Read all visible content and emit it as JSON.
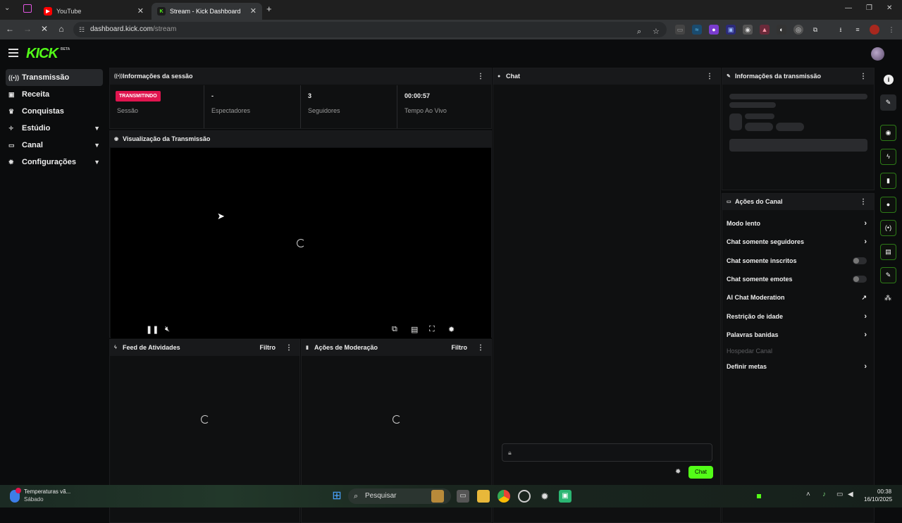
{
  "browser": {
    "tabs": [
      {
        "title": "YouTube",
        "favicon": "youtube-icon"
      },
      {
        "title": "Stream - Kick Dashboard",
        "favicon": "kick-icon",
        "active": true
      }
    ],
    "url_host": "dashboard.kick.com",
    "url_path": "/stream"
  },
  "app": {
    "logo": "KICK",
    "logo_badge": "BETA",
    "accent": "#53fc18",
    "live_color": "#e0154f"
  },
  "sidebar": {
    "items": [
      {
        "label": "Transmissão",
        "icon": "broadcast-icon",
        "active": true
      },
      {
        "label": "Receita",
        "icon": "wallet-icon"
      },
      {
        "label": "Conquistas",
        "icon": "trophy-icon"
      },
      {
        "label": "Estúdio",
        "icon": "studio-icon",
        "expandable": true
      },
      {
        "label": "Canal",
        "icon": "channel-icon",
        "expandable": true
      },
      {
        "label": "Configurações",
        "icon": "gear-icon",
        "expandable": true
      }
    ]
  },
  "session": {
    "title": "Informações da sessão",
    "badge": "TRANSMITINDO",
    "stats": [
      {
        "label": "Sessão",
        "value": ""
      },
      {
        "label": "Espectadores",
        "value": "-"
      },
      {
        "label": "Seguidores",
        "value": "3"
      },
      {
        "label": "Tempo Ao Vivo",
        "value": "00:00:57"
      }
    ]
  },
  "preview": {
    "title": "Visualização da Transmissão"
  },
  "activity": {
    "title": "Feed de Atividades",
    "filter": "Filtro"
  },
  "moderation": {
    "title": "Ações de Moderação",
    "filter": "Filtro"
  },
  "chat": {
    "title": "Chat",
    "send_label": "Chat"
  },
  "stream_info": {
    "title": "Informações da transmissão"
  },
  "channel_actions": {
    "title": "Ações do Canal",
    "items": [
      {
        "label": "Modo lento",
        "control": "arrow"
      },
      {
        "label": "Chat somente seguidores",
        "control": "arrow"
      },
      {
        "label": "Chat somente inscritos",
        "control": "toggle",
        "on": false
      },
      {
        "label": "Chat somente emotes",
        "control": "toggle",
        "on": false
      },
      {
        "label": "AI Chat Moderation",
        "control": "external"
      },
      {
        "label": "Restrição de idade",
        "control": "arrow"
      },
      {
        "label": "Palavras banidas",
        "control": "arrow"
      },
      {
        "label": "Hospedar Canal",
        "control": "none",
        "disabled": true
      },
      {
        "label": "Definir metas",
        "control": "arrow"
      }
    ]
  },
  "taskbar": {
    "weather_title": "Temperaturas vã...",
    "weather_sub": "Sábado",
    "search": "Pesquisar",
    "time": "00:38",
    "date": "16/10/2025"
  }
}
